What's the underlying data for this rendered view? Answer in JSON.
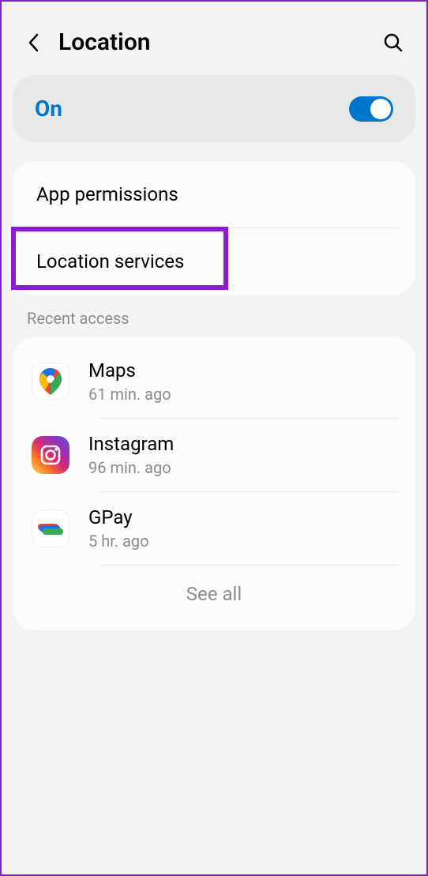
{
  "header": {
    "title": "Location"
  },
  "toggle": {
    "label": "On",
    "state": true
  },
  "menu": {
    "app_permissions": "App permissions",
    "location_services": "Location services"
  },
  "recent": {
    "header": "Recent access",
    "apps": [
      {
        "name": "Maps",
        "time": "61 min. ago",
        "icon": "maps"
      },
      {
        "name": "Instagram",
        "time": "96 min. ago",
        "icon": "instagram"
      },
      {
        "name": "GPay",
        "time": "5 hr. ago",
        "icon": "gpay"
      }
    ],
    "see_all": "See all"
  }
}
